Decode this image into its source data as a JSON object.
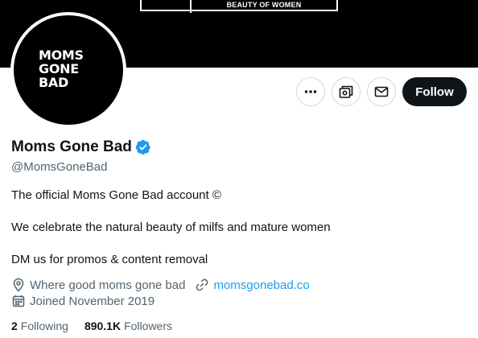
{
  "banner": {
    "text": "BEAUTY OF WOMEN"
  },
  "avatar": {
    "logo_lines": [
      "MOMS",
      "GONE",
      "BAD"
    ]
  },
  "actions": {
    "more_icon": "more-horizontal-icon",
    "subscriptions_icon": "subscriptions-icon",
    "message_icon": "envelope-icon",
    "follow_label": "Follow"
  },
  "profile": {
    "name": "Moms Gone Bad",
    "verified_icon": "verified-badge-icon",
    "handle": "@MomsGoneBad",
    "bio": [
      "The official Moms Gone Bad account ©",
      "We celebrate the natural beauty of milfs and mature women",
      "DM us for promos & content removal"
    ],
    "location": "Where good moms gone bad",
    "website": "momsgonebad.co",
    "joined": "Joined November 2019",
    "following_count": "2",
    "following_label": "Following",
    "followers_count": "890.1K",
    "followers_label": "Followers"
  },
  "colors": {
    "accent": "#1d9bf0",
    "text_primary": "#0f1419",
    "text_secondary": "#536471",
    "border": "#cfd9de",
    "banner": "#000000"
  }
}
